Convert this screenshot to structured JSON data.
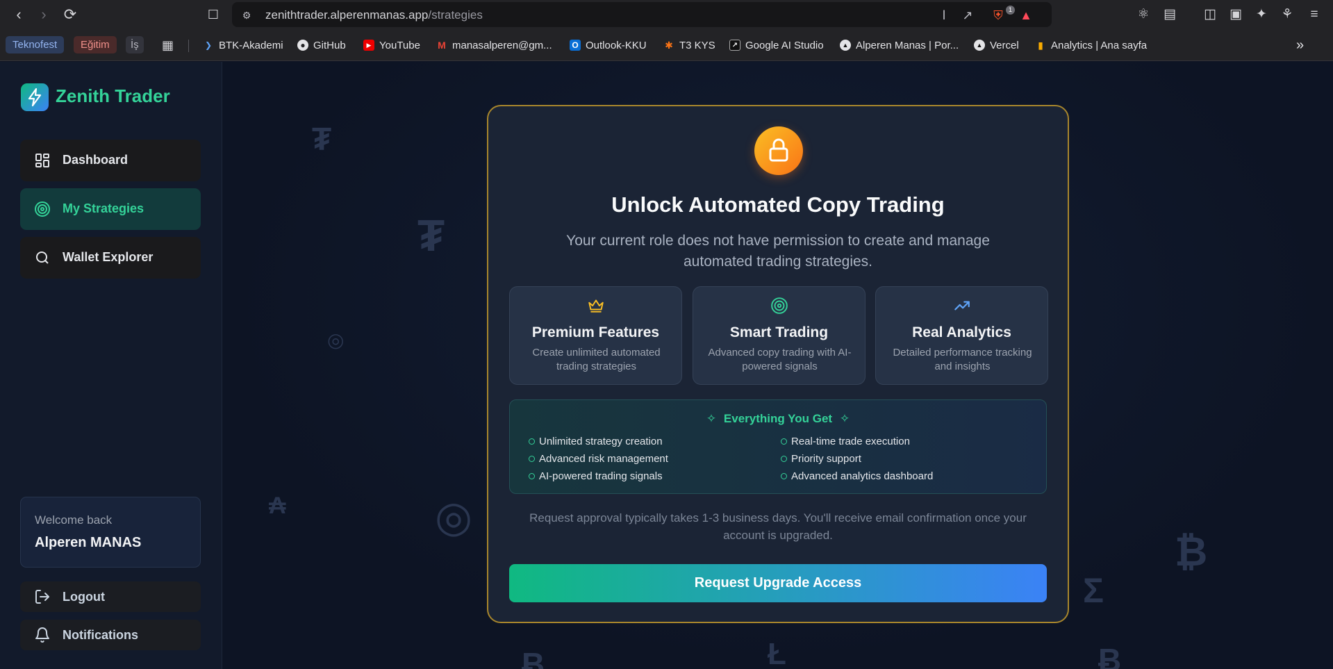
{
  "browser": {
    "url_host": "zenithtrader.alperenmanas.app",
    "url_path": "/strategies",
    "shield_badge": "1",
    "bookmarks": {
      "chips": [
        "Teknofest",
        "Eğitim",
        "İş"
      ],
      "items": [
        "BTK-Akademi",
        "GitHub",
        "YouTube",
        "manasalperen@gm...",
        "Outlook-KKU",
        "T3 KYS",
        "Google AI Studio",
        "Alperen Manas | Por...",
        "Vercel",
        "Analytics | Ana sayfa"
      ]
    }
  },
  "app": {
    "name": "Zenith Trader",
    "nav": [
      "Dashboard",
      "My Strategies",
      "Wallet Explorer"
    ],
    "active_nav": "My Strategies",
    "welcome_label": "Welcome back",
    "user_name": "Alperen MANAS",
    "logout_label": "Logout",
    "notifications_label": "Notifications"
  },
  "background_symbols": [
    "₮",
    "₮",
    "◎",
    "₳",
    "◎",
    "Ł",
    "Σ",
    "₿",
    "Ƀ",
    "Ƀ"
  ],
  "card": {
    "title": "Unlock Automated Copy Trading",
    "subtitle": "Your current role does not have permission to create and manage automated trading strategies.",
    "features": [
      {
        "icon": "crown-icon",
        "title": "Premium Features",
        "desc": "Create unlimited automated trading strategies"
      },
      {
        "icon": "target-icon",
        "title": "Smart Trading",
        "desc": "Advanced copy trading with AI-powered signals"
      },
      {
        "icon": "trending-up-icon",
        "title": "Real Analytics",
        "desc": "Detailed performance tracking and insights"
      }
    ],
    "everything_title": "Everything You Get",
    "benefits": [
      "Unlimited strategy creation",
      "Advanced risk management",
      "AI-powered trading signals",
      "Real-time trade execution",
      "Priority support",
      "Advanced analytics dashboard"
    ],
    "note": "Request approval typically takes 1-3 business days. You'll receive email confirmation once your account is upgraded.",
    "cta_label": "Request Upgrade Access"
  },
  "colors": {
    "accent_green": "#34d399",
    "accent_blue": "#3b82f6",
    "card_border": "#a8862c",
    "lock_orange": "#f97316"
  }
}
